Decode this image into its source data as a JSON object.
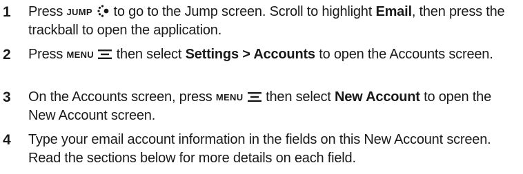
{
  "steps": [
    {
      "number": "1",
      "t1": "Press ",
      "key": "JUMP",
      "key_icon": "jump-key-icon",
      "t2": " to go to the Jump screen. Scroll to highlight ",
      "b1": "Email",
      "t3": ", then press the trackball to open the application."
    },
    {
      "number": "2",
      "t1": "Press ",
      "key": "MENU",
      "key_icon": "menu-key-icon",
      "t2": " then select ",
      "b1": "Settings > Accounts",
      "t3": " to open the Accounts screen."
    },
    {
      "number": "3",
      "t1": "On the Accounts screen, press ",
      "key": "MENU",
      "key_icon": "menu-key-icon",
      "t2": " then select ",
      "b1": "New Account",
      "t3": " to open the New Account screen."
    },
    {
      "number": "4",
      "t1": "Type your email account information in the fields on this New Account screen. Read the sections below for more details on each field."
    }
  ]
}
